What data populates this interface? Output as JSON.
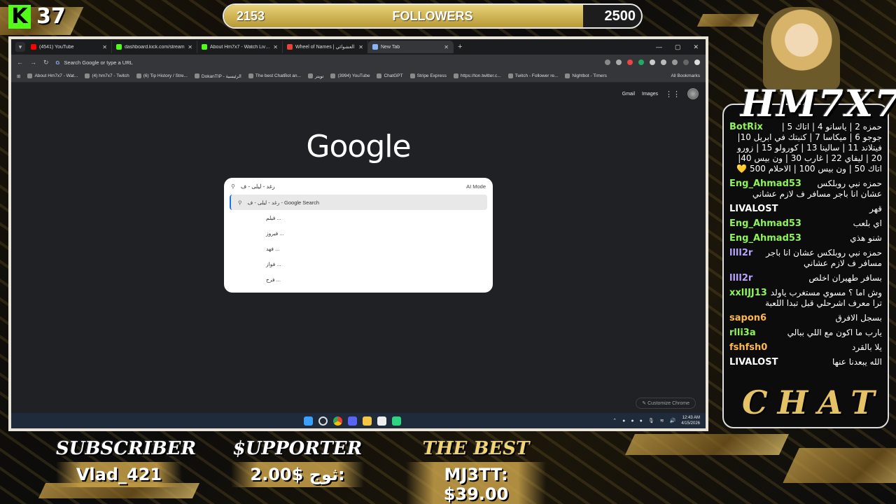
{
  "overlay": {
    "kick_count": "37",
    "followers": {
      "current": "2153",
      "label": "FOLLOWERS",
      "goal": "2500",
      "progress_fraction": 0.8612
    },
    "channel_title": "HM7X7",
    "chat_footer": "CHAT",
    "subscriber": {
      "heading": "SUBSCRIBER",
      "value": "Vlad_421"
    },
    "supporter": {
      "heading": "$UPPORTER",
      "value": "2.00$ ثوج:"
    },
    "best": {
      "heading": "THE BEST",
      "value": "MJ3TT: $39.00"
    }
  },
  "browser": {
    "tabs": [
      {
        "title": "(4541) YouTube",
        "color": "#ff0000"
      },
      {
        "title": "dashboard.kick.com/stream",
        "color": "#53fc18"
      },
      {
        "title": "About Hm7x7 - Watch Live on Kick",
        "color": "#53fc18"
      },
      {
        "title": "Wheel of Names | العشوائي",
        "color": "#ea4335"
      },
      {
        "title": "New Tab",
        "color": "#8ab4f8"
      }
    ],
    "omnibox_placeholder": "Search Google or type a URL",
    "bookmarks": [
      "About Hm7x7 - Wat...",
      "(4) hm7x7 - Twitch",
      "(6) Tip History / Stre...",
      "DokanTIP - الرئيسية",
      "The best ChatBot an...",
      "تويتر",
      "(3994) YouTube",
      "ChatGPT",
      "Stripe Express",
      "https://ton.twitter.c...",
      "Twitch - Follower re...",
      "Nightbot - Timers"
    ],
    "all_bookmarks": "All Bookmarks",
    "top_links": {
      "gmail": "Gmail",
      "images": "Images"
    },
    "logo": "Google",
    "search": {
      "query": "رغد - ليلى - ف",
      "ai_mode": "AI Mode",
      "top_suggestion": "رغد - ليلى - ف - Google Search",
      "suggestions": [
        "... فيلم",
        "... فيروز",
        "... فهد",
        "... فواز",
        "... فرح"
      ]
    },
    "customize": "Customize Chrome",
    "clock": {
      "time": "12:43 AM",
      "date": "4/15/2026"
    }
  },
  "chat": [
    {
      "user": "BotRix",
      "text": "حمزه 2 | ياسانو 4 | اتاك 5 | جوجو 6 | ميكاسا 7 | كنبتك في ابريل 10| فينلاند 11 | سالينا 13 | كورولو 15 | زورو 20 | ليفاي 22 | غارب 30 | ون بيس 40| اتاك 50 | ون بيس 100 | الاحلام 500 💛",
      "kind": "g"
    },
    {
      "user": "Eng_Ahmad53",
      "text": "حمزه نبي روبلكس عشان انا باجر مسافر ف لازم عشاني",
      "kind": "g"
    },
    {
      "user": "LIVALOST",
      "text": "قهر",
      "kind": "w"
    },
    {
      "user": "Eng_Ahmad53",
      "text": "اي بلعب",
      "kind": "g"
    },
    {
      "user": "Eng_Ahmad53",
      "text": "شنو هذي",
      "kind": "g"
    },
    {
      "user": "llll2r",
      "text": "حمزه نبي روبلكس عشان انا باجر مسافر ف لازم عشاني",
      "kind": "pu"
    },
    {
      "user": "llll2r",
      "text": "بسافر طهيران اخلص",
      "kind": "pu"
    },
    {
      "user": "xxlIJJ13",
      "text": "وش اما ؟ مسوي مستغرب ياولد ترا معرف اشرحلي قبل تبدا اللعبة",
      "kind": "g"
    },
    {
      "user": "sapon6",
      "text": "بسجل الافرق",
      "kind": "o"
    },
    {
      "user": "rlli3a",
      "text": "يارب ما اكون مع اللي ببالي",
      "kind": "g"
    },
    {
      "user": "fshfsh0",
      "text": "يلا بالقرد",
      "kind": "o"
    },
    {
      "user": "LIVALOST",
      "text": "الله يبعدنا عنها",
      "kind": "w"
    }
  ]
}
